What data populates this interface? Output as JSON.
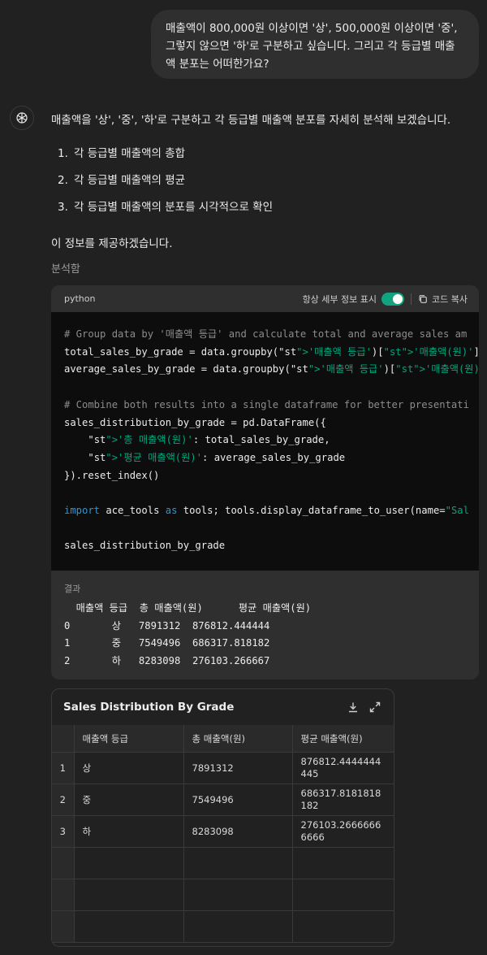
{
  "user_message": "매출액이 800,000원 이상이면 '상', 500,000원 이상이면 '중', 그렇지 않으면 '하'로 구분하고 싶습니다. 그리고 각 등급별 매출액 분포는 어떠한가요?",
  "assistant": {
    "intro": "매출액을 '상', '중', '하'로 구분하고 각 등급별 매출액 분포를 자세히 분석해 보겠습니다.",
    "steps": [
      {
        "num": "1.",
        "text": "각 등급별 매출액의 총합"
      },
      {
        "num": "2.",
        "text": "각 등급별 매출액의 평균"
      },
      {
        "num": "3.",
        "text": "각 등급별 매출액의 분포를 시각적으로 확인"
      }
    ],
    "outro": "이 정보를 제공하겠습니다.",
    "analyzed_label": "분석함"
  },
  "code_block": {
    "language": "python",
    "toggle_label": "항상 세부 정보 표시",
    "toggle_on": true,
    "copy_label": "코드 복사",
    "lines": [
      "# Group data by '매출액 등급' and calculate total and average sales am",
      "total_sales_by_grade = data.groupby('매출액 등급')['매출액(원)'].sum()",
      "average_sales_by_grade = data.groupby('매출액 등급')['매출액(원)'].mean()",
      "",
      "# Combine both results into a single dataframe for better presentati",
      "sales_distribution_by_grade = pd.DataFrame({",
      "    '총 매출액(원)': total_sales_by_grade,",
      "    '평균 매출액(원)': average_sales_by_grade",
      "}).reset_index()",
      "",
      "import ace_tools as tools; tools.display_dataframe_to_user(name=\"Sal",
      "",
      "sales_distribution_by_grade"
    ]
  },
  "result_block": {
    "label": "결과",
    "lines": [
      "  매출액 등급  총 매출액(원)      평균 매출액(원)",
      "0       상   7891312  876812.444444",
      "1       중   7549496  686317.818182",
      "2       하   8283098  276103.266667"
    ]
  },
  "table_card": {
    "title": "Sales Distribution By Grade",
    "columns": [
      "",
      "매출액 등급",
      "총 매출액(원)",
      "평균 매출액(원)"
    ],
    "rows": [
      {
        "idx": "1",
        "grade": "상",
        "total": "7891312",
        "avg": "876812.4444444445"
      },
      {
        "idx": "2",
        "grade": "중",
        "total": "7549496",
        "avg": "686317.8181818182"
      },
      {
        "idx": "3",
        "grade": "하",
        "total": "8283098",
        "avg": "276103.26666666666"
      }
    ],
    "download_icon": "download-icon",
    "expand_icon": "expand-icon"
  },
  "colors": {
    "background": "#212121",
    "bubble": "#2f2f2f",
    "code_bg": "#0d0d0d",
    "toggle_on": "#10a37f",
    "string": "#00a67d",
    "keyword": "#2e95d3",
    "function": "#e9950c"
  }
}
